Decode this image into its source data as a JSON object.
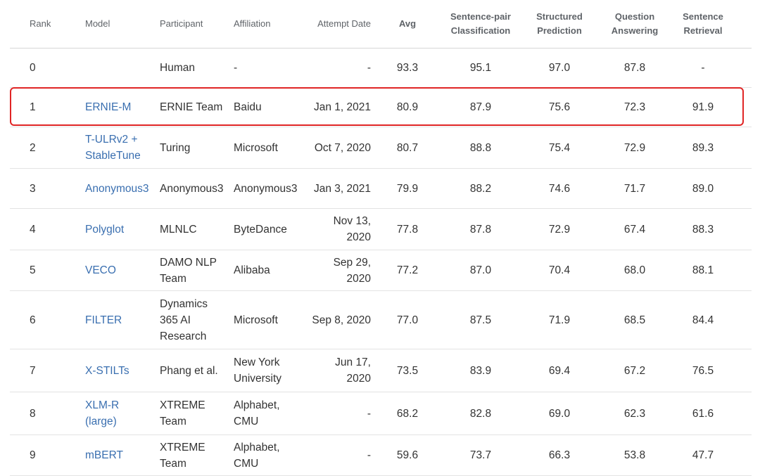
{
  "columns": {
    "rank": "Rank",
    "model": "Model",
    "participant": "Participant",
    "affiliation": "Affiliation",
    "date": "Attempt Date",
    "avg": "Avg",
    "spc": [
      "Sentence-pair",
      "Classification"
    ],
    "sp": [
      "Structured",
      "Prediction"
    ],
    "qa": [
      "Question",
      "Answering"
    ],
    "sr": [
      "Sentence",
      "Retrieval"
    ]
  },
  "rows": [
    {
      "rank": "0",
      "model": [],
      "participant": [
        "Human"
      ],
      "affiliation": [
        "-"
      ],
      "date": [
        "-"
      ],
      "avg": "93.3",
      "spc": "95.1",
      "sp": "97.0",
      "qa": "87.8",
      "sr": "-"
    },
    {
      "rank": "1",
      "model": [
        "ERNIE-M"
      ],
      "participant": [
        "ERNIE Team"
      ],
      "affiliation": [
        "Baidu"
      ],
      "date": [
        "Jan 1, 2021"
      ],
      "avg": "80.9",
      "spc": "87.9",
      "sp": "75.6",
      "qa": "72.3",
      "sr": "91.9"
    },
    {
      "rank": "2",
      "model": [
        "T-ULRv2 +",
        "StableTune"
      ],
      "participant": [
        "Turing"
      ],
      "affiliation": [
        "Microsoft"
      ],
      "date": [
        "Oct 7, 2020"
      ],
      "avg": "80.7",
      "spc": "88.8",
      "sp": "75.4",
      "qa": "72.9",
      "sr": "89.3"
    },
    {
      "rank": "3",
      "model": [
        "Anonymous3"
      ],
      "participant": [
        "Anonymous3"
      ],
      "affiliation": [
        "Anonymous3"
      ],
      "date": [
        "Jan 3, 2021"
      ],
      "avg": "79.9",
      "spc": "88.2",
      "sp": "74.6",
      "qa": "71.7",
      "sr": "89.0"
    },
    {
      "rank": "4",
      "model": [
        "Polyglot"
      ],
      "participant": [
        "MLNLC"
      ],
      "affiliation": [
        "ByteDance"
      ],
      "date": [
        "Nov 13,",
        "2020"
      ],
      "avg": "77.8",
      "spc": "87.8",
      "sp": "72.9",
      "qa": "67.4",
      "sr": "88.3"
    },
    {
      "rank": "5",
      "model": [
        "VECO"
      ],
      "participant": [
        "DAMO NLP",
        "Team"
      ],
      "affiliation": [
        "Alibaba"
      ],
      "date": [
        "Sep 29,",
        "2020"
      ],
      "avg": "77.2",
      "spc": "87.0",
      "sp": "70.4",
      "qa": "68.0",
      "sr": "88.1"
    },
    {
      "rank": "6",
      "model": [
        "FILTER"
      ],
      "participant": [
        "Dynamics",
        "365 AI",
        "Research"
      ],
      "affiliation": [
        "Microsoft"
      ],
      "date": [
        "Sep 8, 2020"
      ],
      "avg": "77.0",
      "spc": "87.5",
      "sp": "71.9",
      "qa": "68.5",
      "sr": "84.4"
    },
    {
      "rank": "7",
      "model": [
        "X-STILTs"
      ],
      "participant": [
        "Phang et al."
      ],
      "affiliation": [
        "New York",
        "University"
      ],
      "date": [
        "Jun 17,",
        "2020"
      ],
      "avg": "73.5",
      "spc": "83.9",
      "sp": "69.4",
      "qa": "67.2",
      "sr": "76.5"
    },
    {
      "rank": "8",
      "model": [
        "XLM-R",
        "(large)"
      ],
      "participant": [
        "XTREME",
        "Team"
      ],
      "affiliation": [
        "Alphabet,",
        "CMU"
      ],
      "date": [
        "-"
      ],
      "avg": "68.2",
      "spc": "82.8",
      "sp": "69.0",
      "qa": "62.3",
      "sr": "61.6"
    },
    {
      "rank": "9",
      "model": [
        "mBERT"
      ],
      "participant": [
        "XTREME",
        "Team"
      ],
      "affiliation": [
        "Alphabet,",
        "CMU"
      ],
      "date": [
        "-"
      ],
      "avg": "59.6",
      "spc": "73.7",
      "sp": "66.3",
      "qa": "53.8",
      "sr": "47.7"
    }
  ]
}
